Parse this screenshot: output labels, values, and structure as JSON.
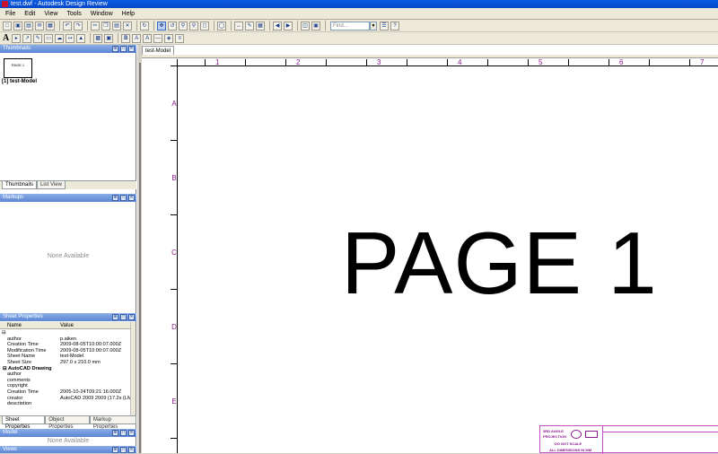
{
  "window": {
    "title": "test.dwf - Autodesk Design Review"
  },
  "menu": [
    "File",
    "Edit",
    "View",
    "Tools",
    "Window",
    "Help"
  ],
  "toolbar": {
    "find_placeholder": "Find..."
  },
  "thumbnails": {
    "title": "Thumbnails",
    "thumb_text": "PAGE 1",
    "thumb_label": "[1] test-Model"
  },
  "left_tabs": [
    "Thumbnails",
    "List View"
  ],
  "markups": {
    "title": "Markups",
    "empty": "None Available"
  },
  "sheet_properties": {
    "title": "Sheet Properties",
    "col_name": "Name",
    "col_value": "Value",
    "rows": [
      {
        "group": false,
        "name": "author",
        "value": "p.aiken"
      },
      {
        "group": false,
        "name": "Creation Time",
        "value": "2009-08-05T10:00:07.000Z"
      },
      {
        "group": false,
        "name": "Modification Time",
        "value": "2009-08-05T10:00:07.000Z"
      },
      {
        "group": false,
        "name": "Sheet Name",
        "value": "test-Model"
      },
      {
        "group": false,
        "name": "Sheet Size",
        "value": "297.0 x 210.0 mm"
      },
      {
        "group": true,
        "name": "AutoCAD Drawing",
        "value": ""
      },
      {
        "group": false,
        "name": "author",
        "value": ""
      },
      {
        "group": false,
        "name": "comments",
        "value": ""
      },
      {
        "group": false,
        "name": "copyright",
        "value": ""
      },
      {
        "group": false,
        "name": "Creation Time",
        "value": "2005-10-24T09:21:16.000Z"
      },
      {
        "group": false,
        "name": "creator",
        "value": "AutoCAD 2009 2009 (17.2s (LMS"
      },
      {
        "group": false,
        "name": "description",
        "value": ""
      }
    ]
  },
  "bottom_tabs": [
    "Sheet Properties",
    "Object Properties",
    "Markup Properties"
  ],
  "model": {
    "title": "Model",
    "empty": "None Available"
  },
  "views": {
    "title": "Views"
  },
  "document": {
    "tab": "test-Model",
    "page_text": "PAGE 1",
    "ruler_numbers": [
      "1",
      "2",
      "3",
      "4",
      "5",
      "6",
      "7"
    ],
    "ruler_letters": [
      "A",
      "B",
      "C",
      "D",
      "E"
    ]
  },
  "title_block": {
    "line1": "3RD ANGLE",
    "line2": "PROJECTION",
    "line3": "DO NOT SCALE",
    "line4": "ALL DIMENSIONS IN MM"
  },
  "colors": {
    "accent": "#0a5ae0",
    "ruler": "#8b1a8b",
    "titleblock": "#c34ec3"
  }
}
